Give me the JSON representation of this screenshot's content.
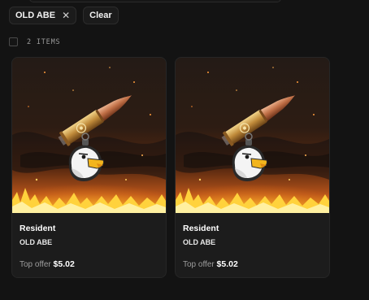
{
  "filters": {
    "chips": [
      {
        "label": "OLD ABE",
        "remove_icon": "close-icon"
      }
    ],
    "clear_label": "Clear"
  },
  "results": {
    "count_label": "2 ITEMS"
  },
  "cards": [
    {
      "title": "Resident",
      "subtitle": "OLD ABE",
      "offer_label": "Top offer",
      "price": "$5.02",
      "artwork": "bullet-and-eagle-charm"
    },
    {
      "title": "Resident",
      "subtitle": "OLD ABE",
      "offer_label": "Top offer",
      "price": "$5.02",
      "artwork": "bullet-and-eagle-charm"
    }
  ],
  "colors": {
    "background": "#131313",
    "card": "#1c1c1c",
    "fire": "#f2a41f",
    "brass": "#c8923f"
  }
}
